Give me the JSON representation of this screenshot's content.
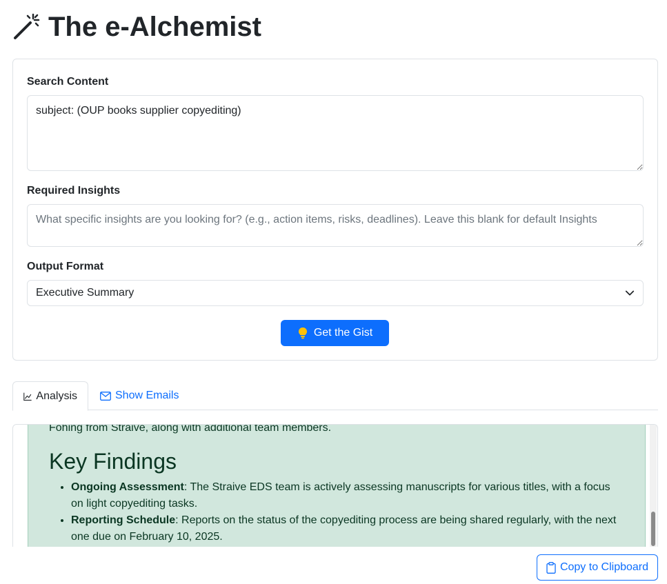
{
  "app": {
    "title": "The e-Alchemist",
    "title_icon": "magic-wand-icon"
  },
  "form": {
    "search": {
      "label": "Search Content",
      "value": "subject: (OUP books supplier copyediting)"
    },
    "insights": {
      "label": "Required Insights",
      "value": "",
      "placeholder": "What specific insights are you looking for? (e.g., action items, risks, deadlines). Leave this blank for default Insights"
    },
    "output_format": {
      "label": "Output Format",
      "selected": "Executive Summary",
      "icon": "chevron-down-icon"
    },
    "submit": {
      "label": "Get the Gist",
      "icon": "lightbulb-icon"
    }
  },
  "tabs": [
    {
      "label": "Analysis",
      "icon": "graph-icon",
      "active": true
    },
    {
      "label": "Show Emails",
      "icon": "envelope-icon",
      "active": false
    }
  ],
  "analysis": {
    "intro_line": "Fohing from Straive, along with additional team members.",
    "heading": "Key Findings",
    "findings": [
      {
        "title": "Ongoing Assessment",
        "text": ": The Straive EDS team is actively assessing manuscripts for various titles, with a focus on light copyediting tasks."
      },
      {
        "title": "Reporting Schedule",
        "text": ": Reports on the status of the copyediting process are being shared regularly, with the next one due on February 10, 2025."
      }
    ],
    "colors": {
      "background": "#d1e7dd",
      "text": "#0a3622"
    }
  },
  "copy_button": {
    "label": "Copy to Clipboard",
    "icon": "clipboard-icon"
  },
  "colors": {
    "accent": "#0d6efd",
    "border": "#dee2e6"
  }
}
